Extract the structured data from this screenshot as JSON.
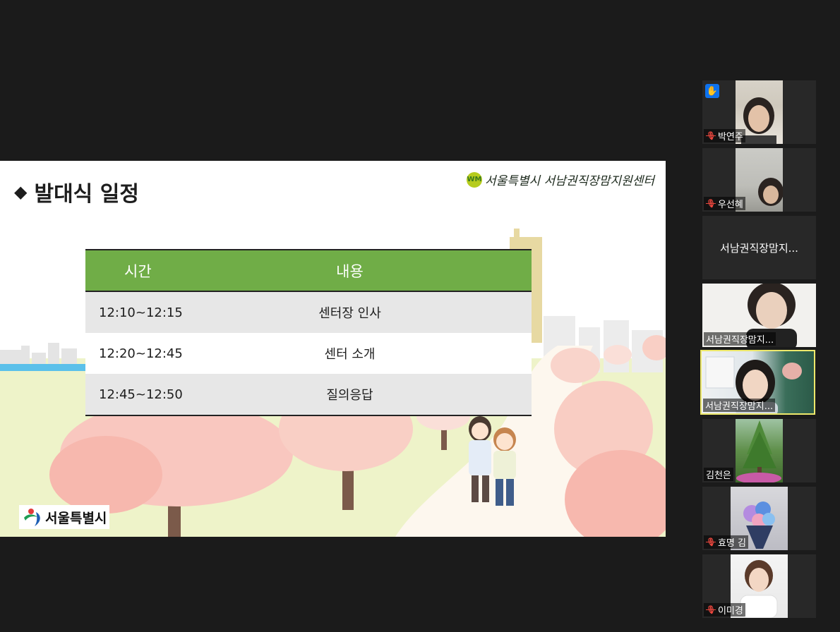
{
  "slide": {
    "title": "발대식 일정",
    "org_logo_text": "서울특별시 서남권직장맘지원센터",
    "org_logo_mark": "WM",
    "seoul_logo_text": "서울특별시",
    "schedule": {
      "headers": [
        "시간",
        "내용"
      ],
      "rows": [
        [
          "12:10~12:15",
          "센터장 인사"
        ],
        [
          "12:20~12:45",
          "센터 소개"
        ],
        [
          "12:45~12:50",
          "질의응답"
        ]
      ]
    }
  },
  "participants": [
    {
      "name": "박연주",
      "muted": true,
      "hand_raised": true,
      "video": true
    },
    {
      "name": "우선혜",
      "muted": true,
      "video": true
    },
    {
      "name": "서남권직장맘지...",
      "muted": false,
      "video": false
    },
    {
      "name": "서남권직장맘지...",
      "muted": false,
      "video": true
    },
    {
      "name": "서남권직장맘지...",
      "muted": false,
      "video": true,
      "active_speaker": true
    },
    {
      "name": "김천은",
      "muted": false,
      "video": true
    },
    {
      "name": "효명 김",
      "muted": true,
      "video": true
    },
    {
      "name": "이미경",
      "muted": true,
      "video": true
    }
  ],
  "icons": {
    "muted": "mic-muted-icon",
    "hand": "raise-hand-icon"
  },
  "colors": {
    "table_header": "#70ad47",
    "row_shade": "#e7e7e7",
    "active_border": "#ede86b",
    "hand_badge": "#0e72ed",
    "muted_mic": "#e8463d"
  }
}
